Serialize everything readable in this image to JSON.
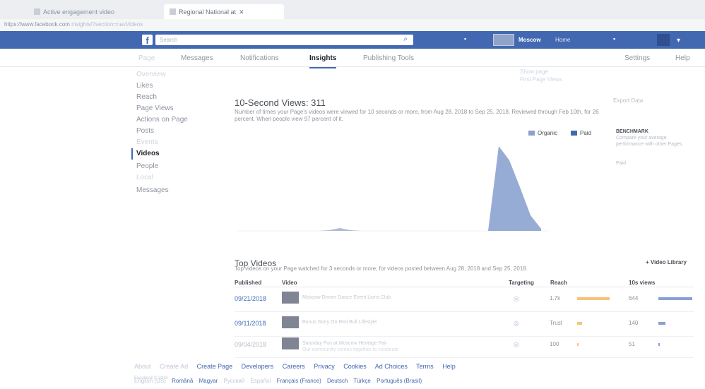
{
  "browser": {
    "tabs": [
      {
        "label": "Active engagement video"
      },
      {
        "label": "Regional National at"
      }
    ],
    "url": "https://www.facebook.com",
    "url_tail": "insights/?section=navVideos"
  },
  "fb": {
    "search_placeholder": "Search",
    "page_name": "Moscow",
    "home_label": "Home"
  },
  "nav": {
    "tabs": [
      "Page",
      "Messages",
      "Notifications",
      "Insights",
      "Publishing Tools"
    ],
    "settings": "Settings",
    "help": "Help"
  },
  "sidebar": {
    "items": [
      "Overview",
      "Likes",
      "Reach",
      "Page Views",
      "Actions on Page",
      "Posts",
      "Events",
      "Videos",
      "People",
      "Local",
      "Messages"
    ]
  },
  "tooltip": {
    "line1": "Show page",
    "line2": "First Page Views"
  },
  "chart_section": {
    "title": "10-Second Views: 311",
    "description": "Number of times your Page's videos were viewed for 10 seconds or more, from Aug 28, 2018 to Sep 25, 2018. Reviewed through Feb 10th, for 26 percent. When people view 97 percent of it.",
    "export": "Export Data",
    "legend": [
      {
        "name": "Organic",
        "color": "#8fa0c9"
      },
      {
        "name": "Paid",
        "color": "#4268b2"
      }
    ],
    "side_title": "BENCHMARK",
    "side_text": "Compare your average performance with other Pages",
    "side_link": "Paid"
  },
  "chart_data": {
    "type": "area",
    "x_range": [
      "Aug 28, 2018",
      "Sep 25, 2018"
    ],
    "series": [
      {
        "name": "Organic",
        "values": [
          0,
          0,
          0,
          0,
          0,
          0,
          0,
          0,
          1,
          4,
          1,
          0,
          0,
          0,
          0,
          0,
          0,
          0,
          0,
          0,
          0,
          0,
          0,
          0,
          0,
          0,
          0,
          0,
          0
        ]
      },
      {
        "name": "Paid",
        "values": [
          0,
          0,
          0,
          0,
          0,
          0,
          0,
          0,
          0,
          0,
          0,
          0,
          0,
          0,
          0,
          0,
          0,
          0,
          0,
          0,
          0,
          0,
          0,
          0,
          120,
          100,
          62,
          22,
          3
        ]
      }
    ]
  },
  "top_videos": {
    "title": "Top Videos",
    "description": "Top videos on your Page watched for 3 seconds or more, for videos posted between Aug 28, 2018 and Sep 25, 2018.",
    "library": "Video Library",
    "headers": {
      "published": "Published",
      "video": "Video",
      "targeting": "Targeting",
      "reach": "Reach",
      "views": "10s views"
    },
    "rows": [
      {
        "date": "09/21/2018",
        "title": "Moscow Dinner Dance Event Lions Club",
        "subtitle": "",
        "reach": "1.7k",
        "reach_frac": 0.7,
        "views": "644",
        "views_frac": 0.8
      },
      {
        "date": "09/11/2018",
        "title": "Bonus Story On Red Bull Lifestyle",
        "subtitle": "",
        "reach": "Trust",
        "reach_frac": 0.1,
        "views": "140",
        "views_frac": 0.17
      },
      {
        "date": "09/04/2018",
        "title": "Saturday Fun at Moscow Heritage Fair",
        "subtitle": "Our community comes together to celebrate",
        "reach": "100",
        "reach_frac": 0.02,
        "views": "51",
        "views_frac": 0.03
      }
    ]
  },
  "footer": {
    "links": [
      "About",
      "Create Ad",
      "Create Page",
      "Developers",
      "Careers",
      "Privacy",
      "Cookies",
      "Ad Choices",
      "Terms",
      "Help"
    ],
    "copyright": "Facebook © 2018",
    "languages": [
      "English (US)",
      "Română",
      "Magyar",
      "Русский",
      "Español",
      "Français (France)",
      "Deutsch",
      "Türkçe",
      "Português (Brasil)"
    ]
  }
}
